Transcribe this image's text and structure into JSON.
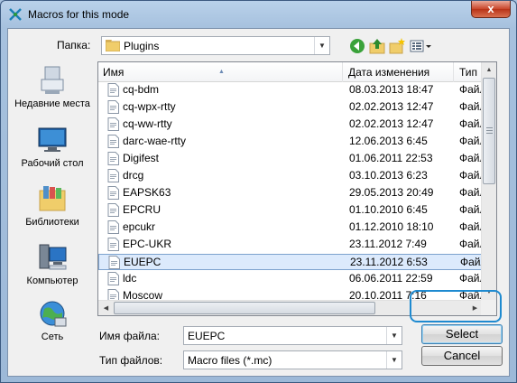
{
  "window": {
    "title": "Macros for this mode",
    "close_label": "x"
  },
  "folder": {
    "label": "Папка:",
    "value": "Plugins"
  },
  "toolbar": {
    "icons": [
      "back-icon",
      "up-folder-icon",
      "new-folder-icon",
      "view-menu-icon"
    ]
  },
  "places": [
    {
      "label": "Недавние места",
      "icon": "recent-places-icon"
    },
    {
      "label": "Рабочий стол",
      "icon": "desktop-icon"
    },
    {
      "label": "Библиотеки",
      "icon": "libraries-icon"
    },
    {
      "label": "Компьютер",
      "icon": "computer-icon"
    },
    {
      "label": "Сеть",
      "icon": "network-icon"
    }
  ],
  "columns": {
    "name": "Имя",
    "date": "Дата изменения",
    "type": "Тип"
  },
  "files": [
    {
      "name": "cq-bdm",
      "date": "08.03.2013 18:47",
      "type": "Файл"
    },
    {
      "name": "cq-wpx-rtty",
      "date": "02.02.2013 12:47",
      "type": "Файл"
    },
    {
      "name": "cq-ww-rtty",
      "date": "02.02.2013 12:47",
      "type": "Файл"
    },
    {
      "name": "darc-wae-rtty",
      "date": "12.06.2013 6:45",
      "type": "Файл"
    },
    {
      "name": "Digifest",
      "date": "01.06.2011 22:53",
      "type": "Файл"
    },
    {
      "name": "drcg",
      "date": "03.10.2013 6:23",
      "type": "Файл"
    },
    {
      "name": "EAPSK63",
      "date": "29.05.2013 20:49",
      "type": "Файл"
    },
    {
      "name": "EPCRU",
      "date": "01.10.2010 6:45",
      "type": "Файл"
    },
    {
      "name": "epcukr",
      "date": "01.12.2010 18:10",
      "type": "Файл"
    },
    {
      "name": "EPC-UKR",
      "date": "23.11.2012 7:49",
      "type": "Файл"
    },
    {
      "name": "EUEPC",
      "date": "23.11.2012 6:53",
      "type": "Файл"
    },
    {
      "name": "ldc",
      "date": "06.06.2011 22:59",
      "type": "Файл"
    },
    {
      "name": "Moscow",
      "date": "20.10.2011 7:16",
      "type": "Файл"
    }
  ],
  "selected_index": 10,
  "filename": {
    "label": "Имя файла:",
    "value": "EUEPC"
  },
  "filetype": {
    "label": "Тип файлов:",
    "value": "Macro files (*.mc)"
  },
  "buttons": {
    "select": "Select",
    "cancel": "Cancel"
  },
  "colors": {
    "selection_bg": "#dceafc",
    "highlight_ring": "#1e8ad0"
  }
}
